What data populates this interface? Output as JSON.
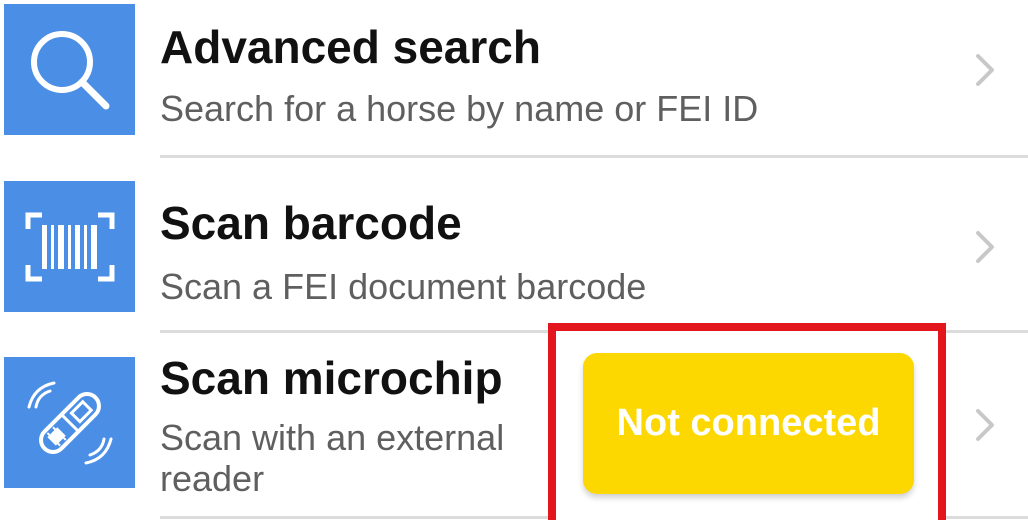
{
  "menu": {
    "advanced_search": {
      "title": "Advanced search",
      "subtitle": "Search for a horse by name or FEI ID",
      "icon": "search-icon"
    },
    "scan_barcode": {
      "title": "Scan barcode",
      "subtitle": "Scan a FEI document barcode",
      "icon": "barcode-icon"
    },
    "scan_microchip": {
      "title": "Scan microchip",
      "subtitle_line1": "Scan with an external",
      "subtitle_line2": "reader",
      "icon": "microchip-icon"
    }
  },
  "status_badge": {
    "label": "Not connected",
    "color": "#fcd700",
    "highlight_color": "#e3161d"
  },
  "colors": {
    "icon_background": "#4a8ee6"
  }
}
